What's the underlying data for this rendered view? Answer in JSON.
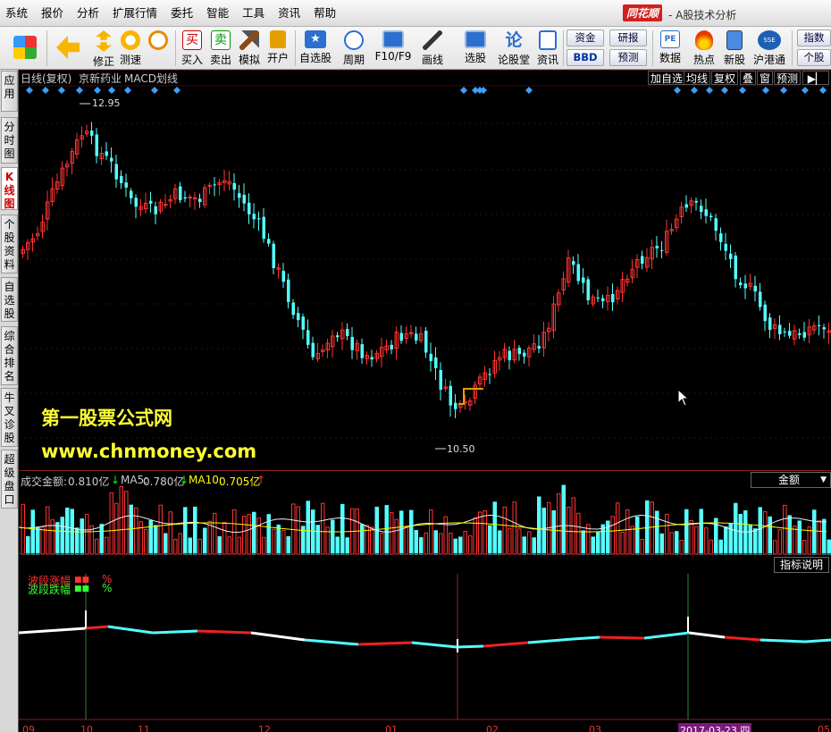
{
  "menu": [
    "系统",
    "报价",
    "分析",
    "扩展行情",
    "委托",
    "智能",
    "工具",
    "资讯",
    "帮助"
  ],
  "brand": "同花顺",
  "app_title": "- A股技术分析",
  "toolbar": {
    "buttons": [
      {
        "label": "",
        "icon": "windows-icon"
      },
      {
        "label": "",
        "icon": "back-arrow-icon"
      },
      {
        "label": "修正",
        "icon": "updown-arrows-icon"
      },
      {
        "label": "测速",
        "icon": "speed-icon"
      },
      {
        "label": "买入",
        "icon": "buy-icon"
      },
      {
        "label": "卖出",
        "icon": "sell-icon"
      },
      {
        "label": "模拟",
        "icon": "hammer-icon"
      },
      {
        "label": "开户",
        "icon": "lock-icon"
      },
      {
        "label": "自选股",
        "icon": "star-icon"
      },
      {
        "label": "周期",
        "icon": "clock-icon"
      },
      {
        "label": "F10/F9",
        "icon": "f10-icon"
      },
      {
        "label": "画线",
        "icon": "pen-icon"
      },
      {
        "label": "选股",
        "icon": "screen-icon"
      },
      {
        "label": "论股堂",
        "icon": "discuss-icon"
      },
      {
        "label": "资讯",
        "icon": "news-icon"
      },
      {
        "label": "数据",
        "icon": "pe-icon"
      },
      {
        "label": "热点",
        "icon": "hot-icon"
      },
      {
        "label": "新股",
        "icon": "newstock-icon"
      },
      {
        "label": "沪港通",
        "icon": "hk-icon"
      }
    ],
    "small_buttons": [
      "资金",
      "BBD",
      "研报",
      "预测",
      "指数",
      "个股"
    ]
  },
  "sidebar": [
    "应用",
    "分时图",
    "K线图",
    "个股资料",
    "自选股",
    "综合排名",
    "牛叉诊股",
    "超级盘口"
  ],
  "chart_header": {
    "period": "日线(复权)",
    "stock": "京新药业",
    "indicator": "MACD划线",
    "buttons": [
      "加自选",
      "均线",
      "复权",
      "叠",
      "窗",
      "预测"
    ]
  },
  "price_labels": {
    "high": "12.95",
    "low": "10.50"
  },
  "watermark": {
    "line1": "第一股票公式网",
    "line2": "www.chnmoney.com"
  },
  "volume_header": {
    "label": "成交金额:",
    "value": "0.810亿",
    "ma5_label": "MA5:",
    "ma5_value": "0.780亿",
    "ma10_label": "MA10:",
    "ma10_value": "0.705亿",
    "selector": "金额"
  },
  "indicator_panel": {
    "explain_button": "指标说明",
    "legend_rise": "波段涨幅",
    "legend_fall": "波段跌幅",
    "unit": "%"
  },
  "x_axis": [
    "09",
    "10",
    "11",
    "12",
    "01",
    "02",
    "03",
    "05"
  ],
  "cursor_date": "2017-03-23 四",
  "colors": {
    "up": "#ff3232",
    "down": "#54ffff",
    "ma_white": "#ffffff",
    "ma_yellow": "#ffff00",
    "watermark": "#ffff33"
  }
}
